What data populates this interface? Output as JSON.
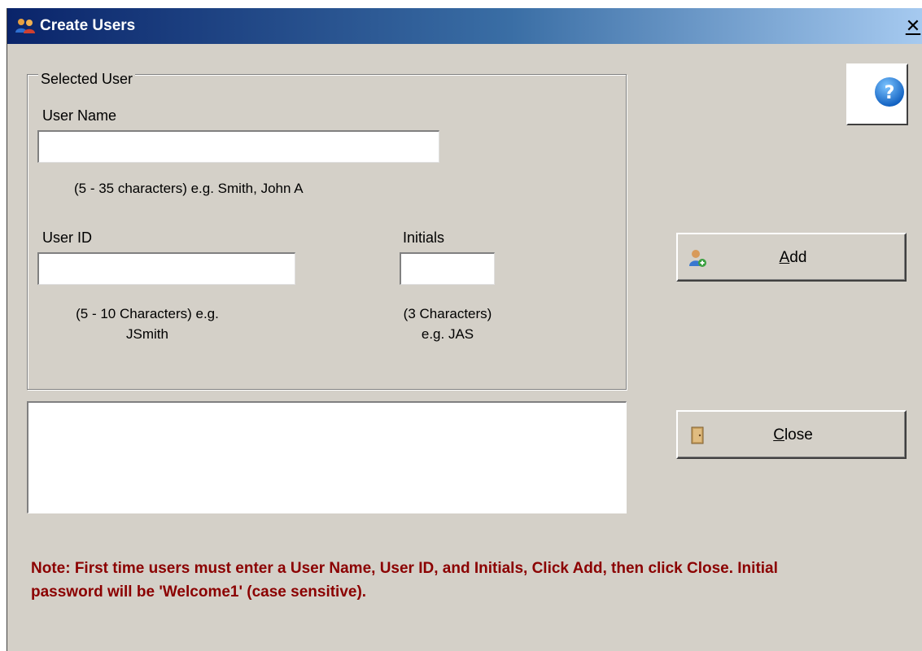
{
  "window": {
    "title": "Create Users",
    "close_glyph": "✕"
  },
  "group": {
    "legend": "Selected User",
    "user_name": {
      "label": "User Name",
      "value": "",
      "hint": "(5 - 35 characters) e.g. Smith, John A"
    },
    "user_id": {
      "label": "User ID",
      "value": "",
      "hint_line1": "(5 - 10 Characters) e.g.",
      "hint_line2": "JSmith"
    },
    "initials": {
      "label": "Initials",
      "value": "",
      "hint_line1": "(3 Characters)",
      "hint_line2": "e.g. JAS"
    }
  },
  "buttons": {
    "help_icon": "help-question-icon",
    "add": {
      "mnemonic": "A",
      "rest": "dd",
      "icon": "add-user-icon"
    },
    "close": {
      "mnemonic": "C",
      "rest": "lose",
      "icon": "door-icon"
    }
  },
  "message_box": {
    "text": ""
  },
  "note": "Note: First time users must enter a User Name, User ID, and Initials, Click Add, then click Close. Initial password will be 'Welcome1' (case sensitive).",
  "colors": {
    "window_bg": "#d4d0c8",
    "title_start": "#0a246a",
    "title_end": "#a6caf0",
    "note_text": "#8b0000",
    "help_blue": "#1e7ad6"
  }
}
